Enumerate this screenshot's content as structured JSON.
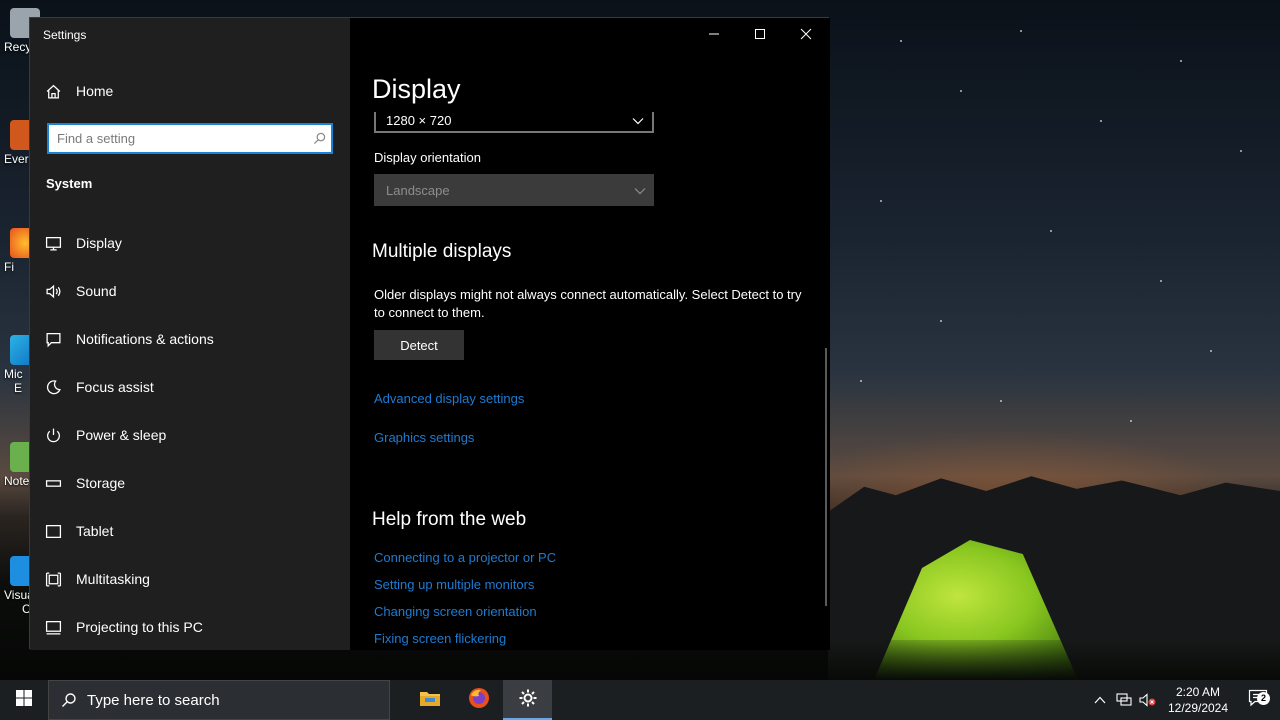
{
  "desktop": {
    "icons": [
      {
        "label": "Recy",
        "icon": "recycle-bin-icon"
      },
      {
        "label": "Ever",
        "icon": "app-shortcut-icon"
      },
      {
        "label": "Fi",
        "icon": "firefox-icon"
      },
      {
        "label": "Mic",
        "icon": "edge-icon"
      },
      {
        "label": "E",
        "icon": "edge-icon"
      },
      {
        "label": "Note",
        "icon": "notepad-icon"
      },
      {
        "label": "Visua",
        "icon": "vscode-icon"
      },
      {
        "label": "C",
        "icon": "vscode-icon"
      }
    ]
  },
  "window": {
    "app_title": "Settings",
    "sidebar": {
      "home_label": "Home",
      "search_placeholder": "Find a setting",
      "section_title": "System",
      "items": [
        {
          "label": "Display",
          "icon": "monitor-icon"
        },
        {
          "label": "Sound",
          "icon": "speaker-icon"
        },
        {
          "label": "Notifications & actions",
          "icon": "message-icon"
        },
        {
          "label": "Focus assist",
          "icon": "moon-icon"
        },
        {
          "label": "Power & sleep",
          "icon": "power-icon"
        },
        {
          "label": "Storage",
          "icon": "storage-icon"
        },
        {
          "label": "Tablet",
          "icon": "tablet-icon"
        },
        {
          "label": "Multitasking",
          "icon": "multitasking-icon"
        },
        {
          "label": "Projecting to this PC",
          "icon": "projecting-icon"
        }
      ]
    },
    "content": {
      "page_title": "Display",
      "resolution_value": "1280 × 720",
      "orientation_label": "Display orientation",
      "orientation_value": "Landscape",
      "multiple_displays_heading": "Multiple displays",
      "multiple_displays_text": "Older displays might not always connect automatically. Select Detect to try to connect to them.",
      "detect_button": "Detect",
      "advanced_link": "Advanced display settings",
      "graphics_link": "Graphics settings",
      "help_heading": "Help from the web",
      "help_links": [
        "Connecting to a projector or PC",
        "Setting up multiple monitors",
        "Changing screen orientation",
        "Fixing screen flickering"
      ]
    }
  },
  "taskbar": {
    "search_placeholder": "Type here to search",
    "clock_time": "2:20 AM",
    "clock_date": "12/29/2024",
    "notification_count": "2",
    "accent_color": "#69a8e8"
  }
}
